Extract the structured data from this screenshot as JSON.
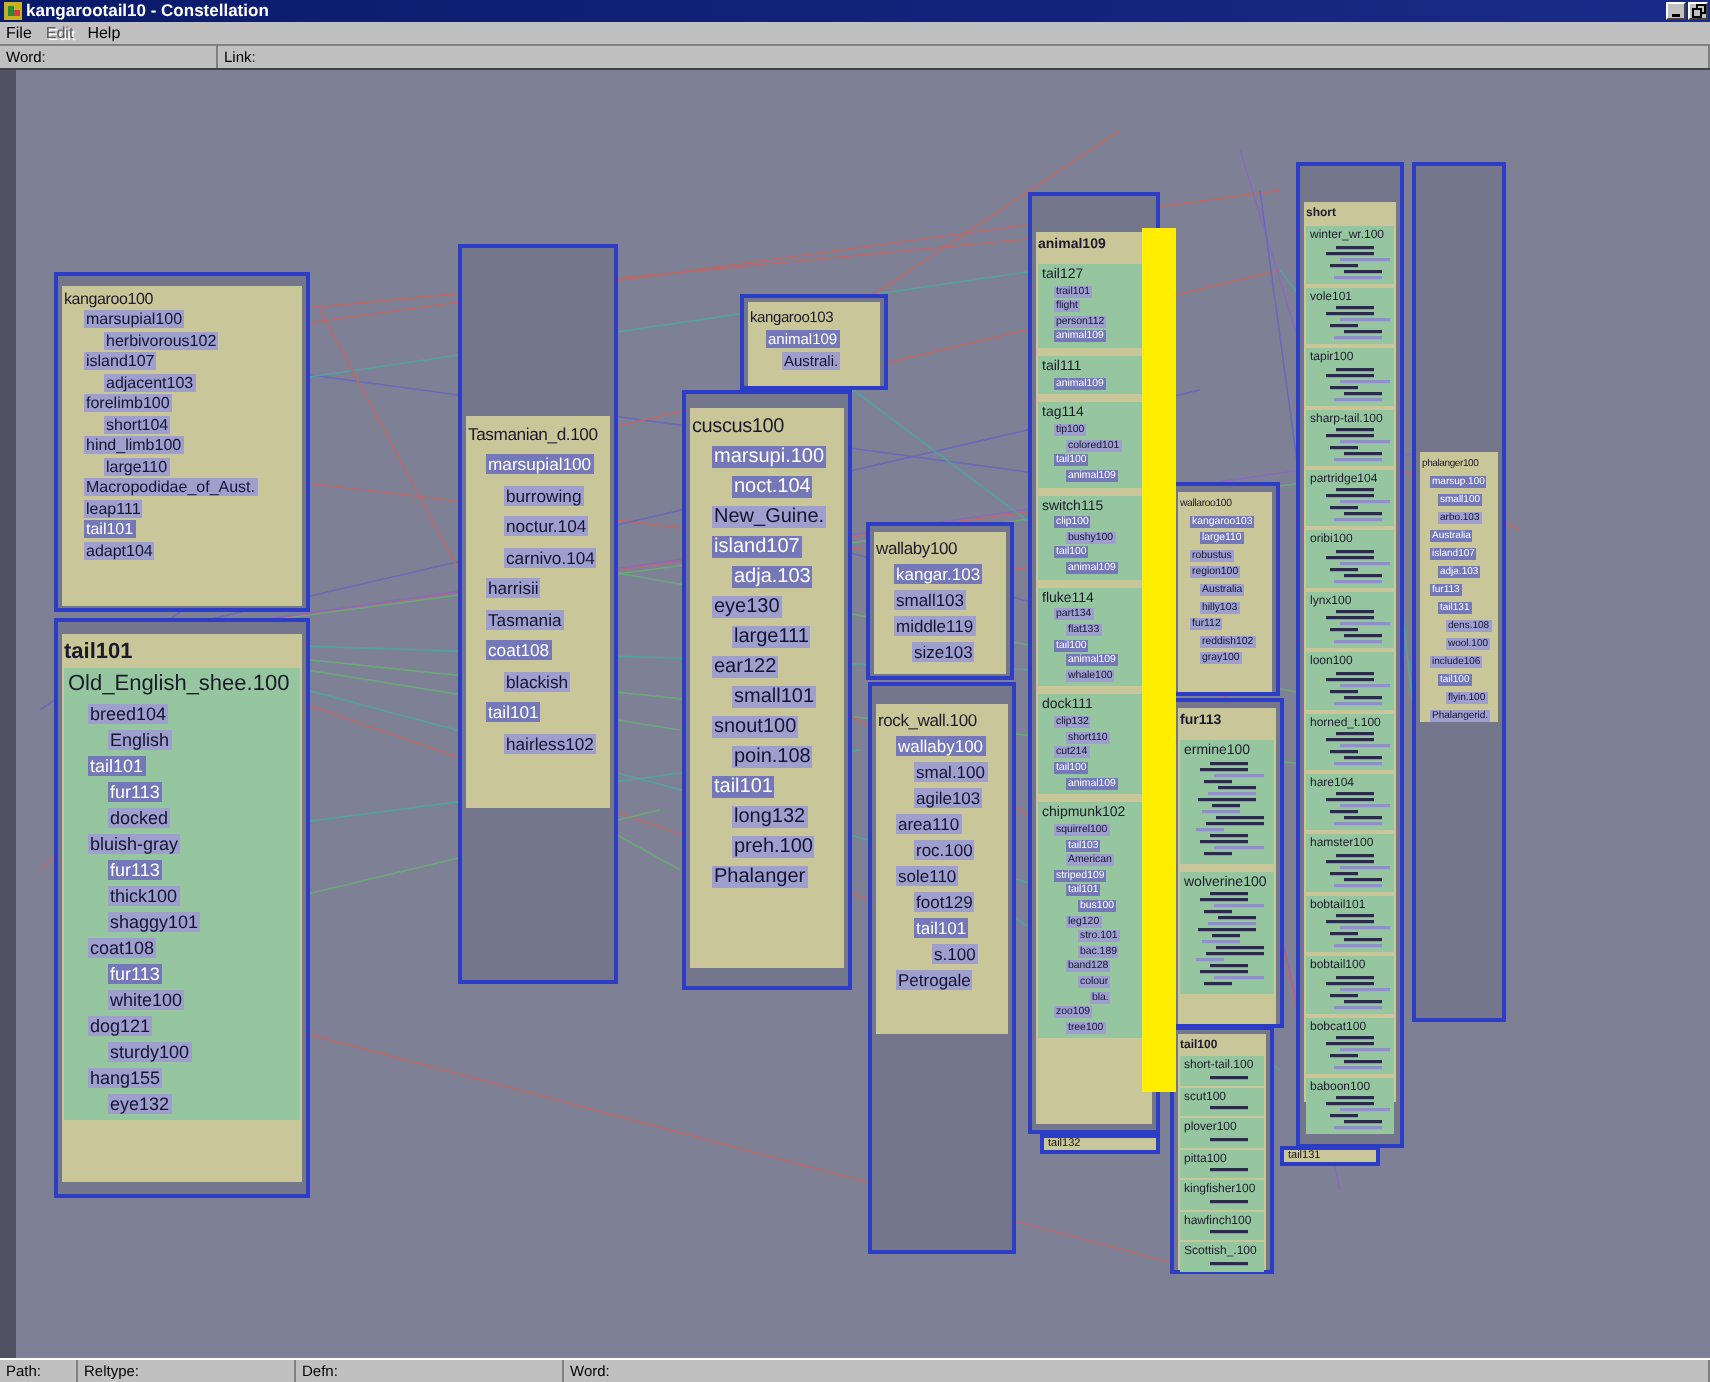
{
  "window": {
    "title": "kangarootail10 - Constellation"
  },
  "menu": [
    {
      "label": "File",
      "disabled": false
    },
    {
      "label": "Edit",
      "disabled": true
    },
    {
      "label": "Help",
      "disabled": false
    }
  ],
  "fields": [
    {
      "label": "Word:"
    },
    {
      "label": "Link:"
    }
  ],
  "panels": [
    {
      "kind": "tree",
      "tree": {
        "word": "kangaroo100",
        "dimmed": false,
        "children": [
          {
            "word": "marsupial100",
            "dimmed": false,
            "children": [
              {
                "word": "herbivorous102",
                "dimmed": false
              }
            ]
          },
          {
            "word": "island107",
            "dimmed": false,
            "children": [
              {
                "word": "adjacent103",
                "dimmed": false
              }
            ]
          },
          {
            "word": "forelimb100",
            "dimmed": false,
            "children": [
              {
                "word": "short104",
                "dimmed": false
              }
            ]
          },
          {
            "word": "hind_limb100",
            "dimmed": false,
            "children": [
              {
                "word": "large110",
                "dimmed": false
              }
            ]
          },
          {
            "word": "Macropodidae_of_Aust.",
            "dimmed": false
          },
          {
            "word": "leap111",
            "dimmed": false
          },
          {
            "word": "tail101",
            "dimmed": true
          },
          {
            "word": "adapt104",
            "dimmed": false
          }
        ]
      }
    },
    {
      "kind": "groups",
      "header": "tail101",
      "groups": [
        {
          "word": "Old_English_shee.100",
          "dimmed": false,
          "collapsed": false,
          "children": [
            {
              "word": "breed104",
              "dimmed": false,
              "children": [
                {
                  "word": "English",
                  "dimmed": false
                }
              ]
            },
            {
              "word": "tail101",
              "dimmed": true,
              "children": [
                {
                  "word": "fur113",
                  "dimmed": true
                },
                {
                  "word": "docked",
                  "dimmed": false
                }
              ]
            },
            {
              "word": "bluish-gray",
              "dimmed": false,
              "children": [
                {
                  "word": "fur113",
                  "dimmed": true
                },
                {
                  "word": "thick100",
                  "dimmed": false
                },
                {
                  "word": "shaggy101",
                  "dimmed": false
                }
              ]
            },
            {
              "word": "coat108",
              "dimmed": false,
              "children": [
                {
                  "word": "fur113",
                  "dimmed": true
                },
                {
                  "word": "white100",
                  "dimmed": false
                }
              ]
            },
            {
              "word": "dog121",
              "dimmed": false,
              "children": [
                {
                  "word": "sturdy100",
                  "dimmed": false
                }
              ]
            },
            {
              "word": "hang155",
              "dimmed": false,
              "children": [
                {
                  "word": "eye132",
                  "dimmed": false
                }
              ]
            }
          ]
        }
      ]
    },
    {
      "kind": "tree",
      "tree": {
        "word": "Tasmanian_d.100",
        "dimmed": false,
        "children": [
          {
            "word": "marsupial100",
            "dimmed": true,
            "children": [
              {
                "word": "burrowing",
                "dimmed": false
              },
              {
                "word": "noctur.104",
                "dimmed": false
              },
              {
                "word": "carnivo.104",
                "dimmed": false
              }
            ]
          },
          {
            "word": "harrisii",
            "dimmed": false
          },
          {
            "word": "Tasmania",
            "dimmed": false
          },
          {
            "word": "coat108",
            "dimmed": true,
            "children": [
              {
                "word": "blackish",
                "dimmed": false
              }
            ]
          },
          {
            "word": "tail101",
            "dimmed": true,
            "children": [
              {
                "word": "hairless102",
                "dimmed": false
              }
            ]
          }
        ]
      }
    },
    {
      "kind": "tree",
      "tree": {
        "word": "kangaroo103",
        "dimmed": false,
        "children": [
          {
            "word": "animal109",
            "dimmed": true,
            "children": [
              {
                "word": "Australi.",
                "dimmed": false
              }
            ]
          }
        ]
      }
    },
    {
      "kind": "tree",
      "tree": {
        "word": "cuscus100",
        "dimmed": false,
        "children": [
          {
            "word": "marsupi.100",
            "dimmed": true,
            "children": [
              {
                "word": "noct.104",
                "dimmed": true
              }
            ]
          },
          {
            "word": "New_Guine.",
            "dimmed": false
          },
          {
            "word": "island107",
            "dimmed": true,
            "children": [
              {
                "word": "adja.103",
                "dimmed": true
              }
            ]
          },
          {
            "word": "eye130",
            "dimmed": false,
            "children": [
              {
                "word": "large111",
                "dimmed": false
              }
            ]
          },
          {
            "word": "ear122",
            "dimmed": false,
            "children": [
              {
                "word": "small101",
                "dimmed": false
              }
            ]
          },
          {
            "word": "snout100",
            "dimmed": false,
            "children": [
              {
                "word": "poin.108",
                "dimmed": false
              }
            ]
          },
          {
            "word": "tail101",
            "dimmed": true,
            "children": [
              {
                "word": "long132",
                "dimmed": false
              },
              {
                "word": "preh.100",
                "dimmed": false
              }
            ]
          },
          {
            "word": "Phalanger",
            "dimmed": false
          }
        ]
      }
    },
    {
      "kind": "tree",
      "tree": {
        "word": "wallaby100",
        "dimmed": false,
        "children": [
          {
            "word": "kangar.103",
            "dimmed": true
          },
          {
            "word": "small103",
            "dimmed": false
          },
          {
            "word": "middle119",
            "dimmed": false,
            "children": [
              {
                "word": "size103",
                "dimmed": false
              }
            ]
          }
        ]
      }
    },
    {
      "kind": "tree",
      "tree": {
        "word": "rock_wall.100",
        "dimmed": false,
        "children": [
          {
            "word": "wallaby100",
            "dimmed": true,
            "children": [
              {
                "word": "smal.100",
                "dimmed": false
              },
              {
                "word": "agile103",
                "dimmed": false
              }
            ]
          },
          {
            "word": "area110",
            "dimmed": false,
            "children": [
              {
                "word": "roc.100",
                "dimmed": false
              }
            ]
          },
          {
            "word": "sole110",
            "dimmed": false,
            "children": [
              {
                "word": "foot129",
                "dimmed": false
              },
              {
                "word": "tail101",
                "dimmed": true,
                "children": [
                  {
                    "word": "s.100",
                    "dimmed": false
                  }
                ]
              }
            ]
          },
          {
            "word": "Petrogale",
            "dimmed": false
          }
        ]
      }
    },
    {
      "kind": "groups",
      "header": "animal109",
      "groups": [
        {
          "word": "tail127",
          "dimmed": false,
          "collapsed": false,
          "children": [
            {
              "word": "trail101",
              "dimmed": false
            },
            {
              "word": "flight",
              "dimmed": false
            },
            {
              "word": "person112",
              "dimmed": false
            },
            {
              "word": "animal109",
              "dimmed": true
            }
          ]
        },
        {
          "word": "tail111",
          "dimmed": false,
          "collapsed": false,
          "children": [
            {
              "word": "animal109",
              "dimmed": true
            }
          ]
        },
        {
          "word": "tag114",
          "dimmed": false,
          "collapsed": false,
          "children": [
            {
              "word": "tip100",
              "dimmed": false,
              "children": [
                {
                  "word": "colored101",
                  "dimmed": false
                }
              ]
            },
            {
              "word": "tail100",
              "dimmed": true,
              "children": [
                {
                  "word": "animal109",
                  "dimmed": true
                }
              ]
            }
          ]
        },
        {
          "word": "switch115",
          "dimmed": false,
          "collapsed": false,
          "children": [
            {
              "word": "clip100",
              "dimmed": true,
              "children": [
                {
                  "word": "bushy100",
                  "dimmed": false
                }
              ]
            },
            {
              "word": "tail100",
              "dimmed": true,
              "children": [
                {
                  "word": "animal109",
                  "dimmed": true
                }
              ]
            }
          ]
        },
        {
          "word": "fluke114",
          "dimmed": false,
          "collapsed": false,
          "children": [
            {
              "word": "part134",
              "dimmed": false,
              "children": [
                {
                  "word": "flat133",
                  "dimmed": false
                }
              ]
            },
            {
              "word": "tail100",
              "dimmed": true,
              "children": [
                {
                  "word": "animal109",
                  "dimmed": true
                },
                {
                  "word": "whale100",
                  "dimmed": false
                }
              ]
            }
          ]
        },
        {
          "word": "dock111",
          "dimmed": false,
          "collapsed": false,
          "children": [
            {
              "word": "clip132",
              "dimmed": false,
              "children": [
                {
                  "word": "short110",
                  "dimmed": false
                }
              ]
            },
            {
              "word": "cut214",
              "dimmed": false
            },
            {
              "word": "tail100",
              "dimmed": true,
              "children": [
                {
                  "word": "animal109",
                  "dimmed": true
                }
              ]
            }
          ]
        },
        {
          "word": "chipmunk102",
          "dimmed": false,
          "collapsed": false,
          "children": [
            {
              "word": "squirrel100",
              "dimmed": false,
              "children": [
                {
                  "word": "tail103",
                  "dimmed": true
                },
                {
                  "word": "American",
                  "dimmed": false
                }
              ]
            },
            {
              "word": "striped109",
              "dimmed": true,
              "children": [
                {
                  "word": "tail101",
                  "dimmed": true,
                  "children": [
                    {
                      "word": "bus100",
                      "dimmed": true
                    }
                  ]
                },
                {
                  "word": "leg120",
                  "dimmed": false,
                  "children": [
                    {
                      "word": "stro.101",
                      "dimmed": false
                    },
                    {
                      "word": "bac.189",
                      "dimmed": false
                    }
                  ]
                },
                {
                  "word": "band128",
                  "dimmed": false,
                  "children": [
                    {
                      "word": "colour",
                      "dimmed": false,
                      "children": [
                        {
                          "word": "bla.",
                          "dimmed": false
                        }
                      ]
                    }
                  ]
                }
              ]
            },
            {
              "word": "zoo109",
              "dimmed": false,
              "children": [
                {
                  "word": "tree100",
                  "dimmed": false
                }
              ]
            }
          ]
        }
      ]
    },
    {
      "kind": "stub",
      "word": "tail132"
    },
    {
      "kind": "tree",
      "tree": {
        "word": "wallaroo100",
        "dimmed": false,
        "children": [
          {
            "word": "kangaroo103",
            "dimmed": true,
            "children": [
              {
                "word": "large110",
                "dimmed": true
              }
            ]
          },
          {
            "word": "robustus",
            "dimmed": false
          },
          {
            "word": "region100",
            "dimmed": false,
            "children": [
              {
                "word": "Australia",
                "dimmed": false
              },
              {
                "word": "hilly103",
                "dimmed": false
              }
            ]
          },
          {
            "word": "fur112",
            "dimmed": false,
            "children": [
              {
                "word": "reddish102",
                "dimmed": false
              },
              {
                "word": "gray100",
                "dimmed": false
              }
            ]
          }
        ]
      }
    },
    {
      "kind": "groups",
      "header": "fur113",
      "groups": [
        {
          "word": "ermine100",
          "dimmed": false,
          "collapsed": true
        },
        {
          "word": "wolverine100",
          "dimmed": false,
          "collapsed": true
        }
      ]
    },
    {
      "kind": "groups",
      "header": "tail100",
      "groups": [
        {
          "word": "short-tail.100",
          "dimmed": false,
          "collapsed": true
        },
        {
          "word": "scut100",
          "dimmed": false,
          "collapsed": true
        },
        {
          "word": "plover100",
          "dimmed": false,
          "collapsed": true
        },
        {
          "word": "pitta100",
          "dimmed": false,
          "collapsed": true
        },
        {
          "word": "kingfisher100",
          "dimmed": false,
          "collapsed": true
        },
        {
          "word": "hawfinch100",
          "dimmed": false,
          "collapsed": true
        },
        {
          "word": "Scottish_.100",
          "dimmed": false,
          "collapsed": true
        }
      ]
    },
    {
      "kind": "groups",
      "header": "short",
      "groups": [
        {
          "word": "winter_wr.100",
          "dimmed": false,
          "collapsed": true
        },
        {
          "word": "vole101",
          "dimmed": false,
          "collapsed": true
        },
        {
          "word": "tapir100",
          "dimmed": false,
          "collapsed": true
        },
        {
          "word": "sharp-tail.100",
          "dimmed": false,
          "collapsed": true
        },
        {
          "word": "partridge104",
          "dimmed": false,
          "collapsed": true
        },
        {
          "word": "oribi100",
          "dimmed": false,
          "collapsed": true
        },
        {
          "word": "lynx100",
          "dimmed": false,
          "collapsed": true
        },
        {
          "word": "loon100",
          "dimmed": false,
          "collapsed": true
        },
        {
          "word": "horned_t.100",
          "dimmed": false,
          "collapsed": true
        },
        {
          "word": "hare104",
          "dimmed": false,
          "collapsed": true
        },
        {
          "word": "hamster100",
          "dimmed": false,
          "collapsed": true
        },
        {
          "word": "bobtail101",
          "dimmed": false,
          "collapsed": true
        },
        {
          "word": "bobtail100",
          "dimmed": false,
          "collapsed": true
        },
        {
          "word": "bobcat100",
          "dimmed": false,
          "collapsed": true
        },
        {
          "word": "baboon100",
          "dimmed": false,
          "collapsed": true
        }
      ]
    },
    {
      "kind": "stub",
      "word": "tail131"
    },
    {
      "kind": "tree",
      "tree": {
        "word": "phalanger100",
        "dimmed": false,
        "children": [
          {
            "word": "marsup.100",
            "dimmed": true,
            "children": [
              {
                "word": "small100",
                "dimmed": true
              },
              {
                "word": "arbo.103",
                "dimmed": false
              }
            ]
          },
          {
            "word": "Australia",
            "dimmed": true
          },
          {
            "word": "island107",
            "dimmed": true,
            "children": [
              {
                "word": "adja.103",
                "dimmed": true
              }
            ]
          },
          {
            "word": "fur113",
            "dimmed": true,
            "children": [
              {
                "word": "tail131",
                "dimmed": true,
                "children": [
                  {
                    "word": "dens.108",
                    "dimmed": false
                  },
                  {
                    "word": "wool.100",
                    "dimmed": false
                  }
                ]
              }
            ]
          },
          {
            "word": "include106",
            "dimmed": false,
            "children": [
              {
                "word": "tail100",
                "dimmed": true,
                "children": [
                  {
                    "word": "flyin.100",
                    "dimmed": false
                  }
                ]
              }
            ]
          },
          {
            "word": "Phalangerid.",
            "dimmed": false
          }
        ]
      }
    }
  ],
  "status_bar": [
    {
      "label": "Path:"
    },
    {
      "label": "Reltype:"
    },
    {
      "label": "Defn:"
    },
    {
      "label": "Word:"
    }
  ]
}
